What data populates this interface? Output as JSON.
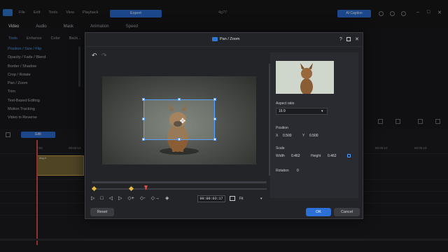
{
  "menu": [
    "File",
    "Edit",
    "Tools",
    "View",
    "Playback"
  ],
  "toolbar": {
    "export_label": "Export",
    "project_title": "4g77",
    "ai_caption_label": "AI Caption"
  },
  "tabs": [
    "Video",
    "Audio",
    "Mask",
    "Animation",
    "Speed"
  ],
  "subtabs": [
    "Tools",
    "Enhance",
    "Color",
    "Back..."
  ],
  "tools_list": [
    "Position / Size / Flip",
    "Opacity / Fade / Blend",
    "Border / Shadow",
    "Crop / Rotate",
    "Pan / Zoom",
    "Trim",
    "Text-Based Editing",
    "Motion Tracking",
    "Video in Reverse"
  ],
  "timeline": {
    "edit_label": "Edit",
    "ticks": [
      "0:00",
      "00:00:10",
      "00:00:10",
      "00:00:18"
    ],
    "clip_label": "dog.h"
  },
  "dialog": {
    "title": "Pan / Zoom",
    "help": "?",
    "timecode": "00:00:03:17",
    "zoom_fit": "Fit",
    "aspect_label": "Aspect ratio",
    "aspect_value": "16:9",
    "position_label": "Position",
    "pos_x_label": "X",
    "pos_x": "0.500",
    "pos_y_label": "Y",
    "pos_y": "0.500",
    "scale_label": "Scale",
    "width_label": "Width",
    "width_value": "0.462",
    "height_label": "Height",
    "height_value": "0.462",
    "rotation_label": "Rotation",
    "rotation_value": "0",
    "reset_label": "Reset",
    "ok_label": "OK",
    "cancel_label": "Cancel"
  },
  "colors": {
    "accent": "#2c6fd6",
    "playhead": "#e14b4b",
    "keyframe": "#e6b840",
    "zoom_box": "#5aa2ff"
  }
}
